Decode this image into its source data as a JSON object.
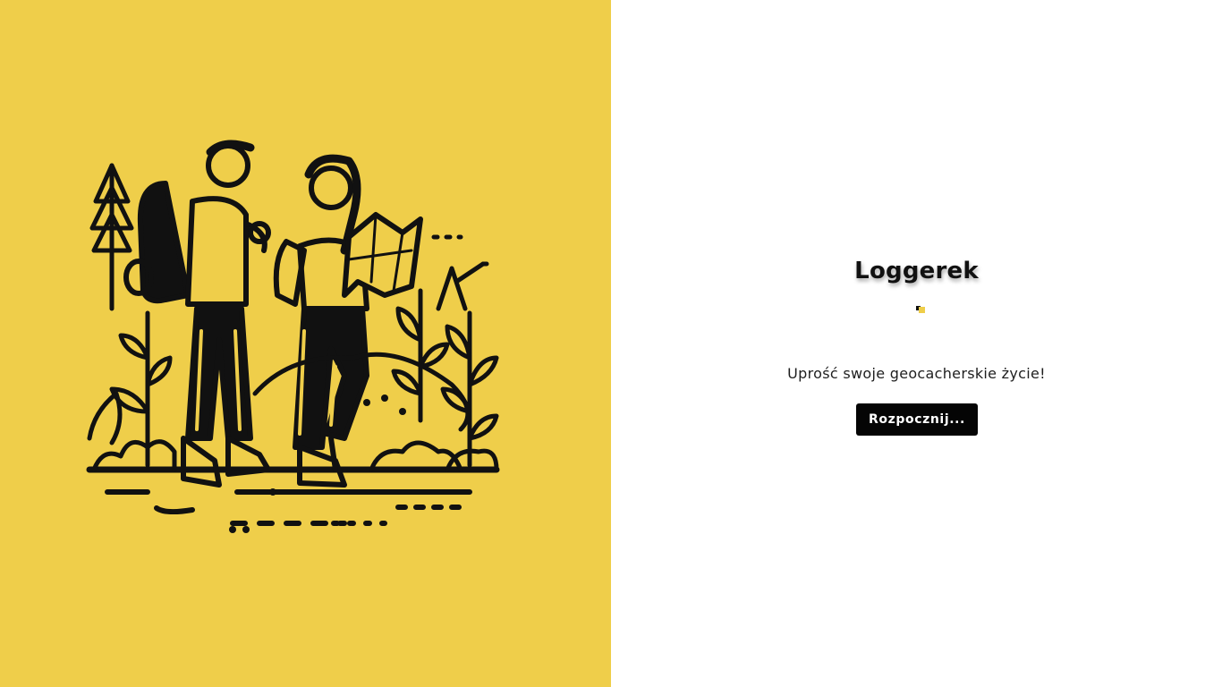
{
  "app": {
    "title": "Loggerek",
    "tagline": "Uprość swoje geocacherskie życie!",
    "start_label": "Rozpocznij..."
  },
  "illustration": {
    "subject": "two hikers reading a map in the woods",
    "icon": "hikers-illustration"
  },
  "colors": {
    "accent": "#efce4a",
    "ink": "#111111",
    "button_bg": "#050505",
    "button_text": "#ffffff",
    "background": "#ffffff"
  }
}
